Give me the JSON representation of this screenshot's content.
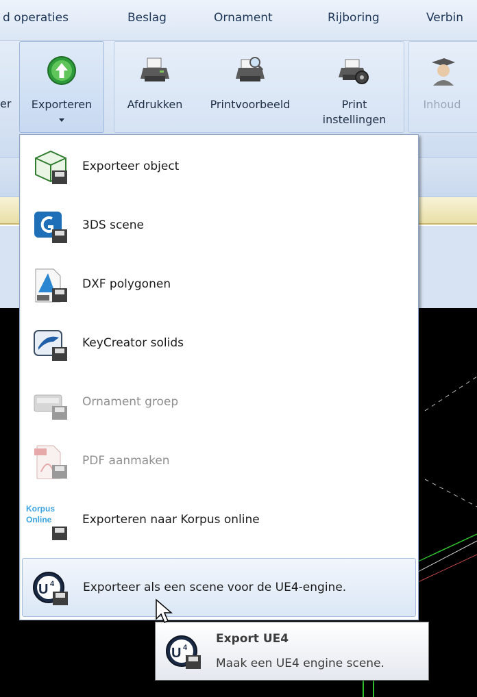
{
  "tabs": [
    "d operaties",
    "Beslag",
    "Ornament",
    "Rijboring",
    "Verbin"
  ],
  "ribbon": {
    "partial_left": "er",
    "export": "Exporteren",
    "print": "Afdrukken",
    "preview": "Printvoorbeeld",
    "settings_line1": "Print",
    "settings_line2": "instellingen",
    "contents": "Inhoud"
  },
  "menu": {
    "items": [
      {
        "label": "Exporteer object",
        "icon": "export-object-icon",
        "enabled": true
      },
      {
        "label": "3DS scene",
        "icon": "3ds-icon",
        "enabled": true
      },
      {
        "label": "DXF polygonen",
        "icon": "dxf-icon",
        "enabled": true
      },
      {
        "label": "KeyCreator solids",
        "icon": "keycreator-icon",
        "enabled": true
      },
      {
        "label": "Ornament groep",
        "icon": "ornament-icon",
        "enabled": false
      },
      {
        "label": "PDF aanmaken",
        "icon": "pdf-icon",
        "enabled": false
      },
      {
        "label": "Exporteren naar Korpus online",
        "icon": "korpus-online-icon",
        "enabled": true
      },
      {
        "label": "Exporteer als een scene voor de UE4-engine.",
        "icon": "ue4-icon",
        "enabled": true
      }
    ],
    "korpus_logo_line1": "Korpus",
    "korpus_logo_line2": "Online"
  },
  "tooltip": {
    "title": "Export UE4",
    "description": "Maak een UE4 engine scene."
  },
  "colors": {
    "ribbon_bg": "#d5e2f3",
    "highlight_border": "#a7bfdf",
    "disabled_text": "#8f8f8f"
  }
}
